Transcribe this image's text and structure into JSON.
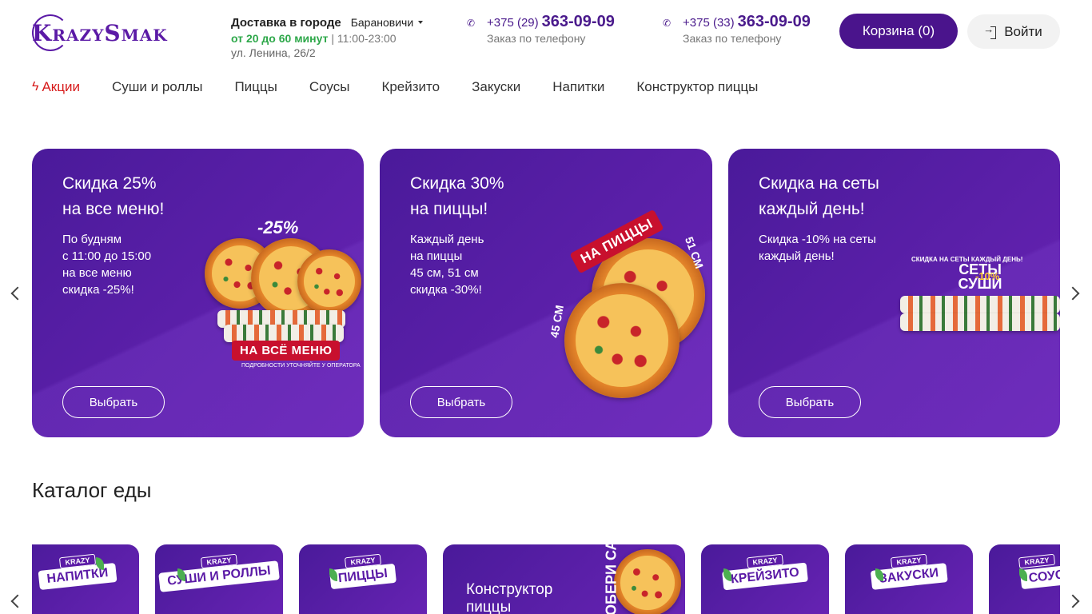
{
  "header": {
    "logo_text": "KrazySmak",
    "delivery_label": "Доставка в городе",
    "city": "Барановичи",
    "delivery_time": "от 20 до 60 минут",
    "hours": "| 11:00-23:00",
    "address": "ул. Ленина, 26/2",
    "phones": [
      {
        "prefix": "+375 (29)",
        "number": "363-09-09",
        "sub": "Заказ по телефону"
      },
      {
        "prefix": "+375 (33)",
        "number": "363-09-09",
        "sub": "Заказ по телефону"
      }
    ],
    "cart_label": "Корзина (0)",
    "login_label": "Войти"
  },
  "nav": {
    "items": [
      "Акции",
      "Суши и роллы",
      "Пиццы",
      "Соусы",
      "Крейзито",
      "Закуски",
      "Напитки",
      "Конструктор пиццы"
    ]
  },
  "banners": [
    {
      "title": "Скидка 25%\nна все меню!",
      "text": "По будням\nс 11:00 до 15:00\nна все меню\nскидка -25%!",
      "button": "Выбрать",
      "art_badge": "-25%",
      "art_tag": "НА ВСЁ МЕНЮ",
      "art_note": "ПОДРОБНОСТИ УТОЧНЯЙТЕ У ОПЕРАТОРА"
    },
    {
      "title": "Скидка 30%\nна пиццы!",
      "text": "Каждый день\nна пиццы\n45 см, 51 см\nскидка -30%!",
      "button": "Выбрать",
      "art_tag": "НА ПИЦЦЫ",
      "art_size1": "51 СМ",
      "art_size2": "45 СМ"
    },
    {
      "title": "Скидка на сеты\nкаждый день!",
      "text": "Скидка -10% на сеты\nкаждый день!",
      "button": "Выбрать",
      "art_caption": "СКИДКА НА СЕТЫ КАЖДЫЙ ДЕНЬ!",
      "art_title": "СЕТЫ СУШИ",
      "art_badge": "-10%"
    }
  ],
  "catalog": {
    "title": "Каталог еды",
    "cards": [
      {
        "tag": "НАПИТКИ",
        "krazy": "KRAZY"
      },
      {
        "tag": "СУШИ И РОЛЛЫ",
        "krazy": "KRAZY"
      },
      {
        "tag": "ПИЦЦЫ",
        "krazy": "KRAZY"
      },
      {
        "label": "Конструктор\nпиццы",
        "art": "СОБЕРИ САМ"
      },
      {
        "tag": "КРЕЙЗИТО",
        "krazy": "KRAZY"
      },
      {
        "tag": "ЗАКУСКИ",
        "krazy": "KRAZY"
      },
      {
        "tag": "СОУСЫ",
        "krazy": "KRAZY"
      }
    ]
  },
  "colors": {
    "brand": "#4a148c",
    "promo_red": "#d71a1a",
    "green": "#2ea84a"
  }
}
